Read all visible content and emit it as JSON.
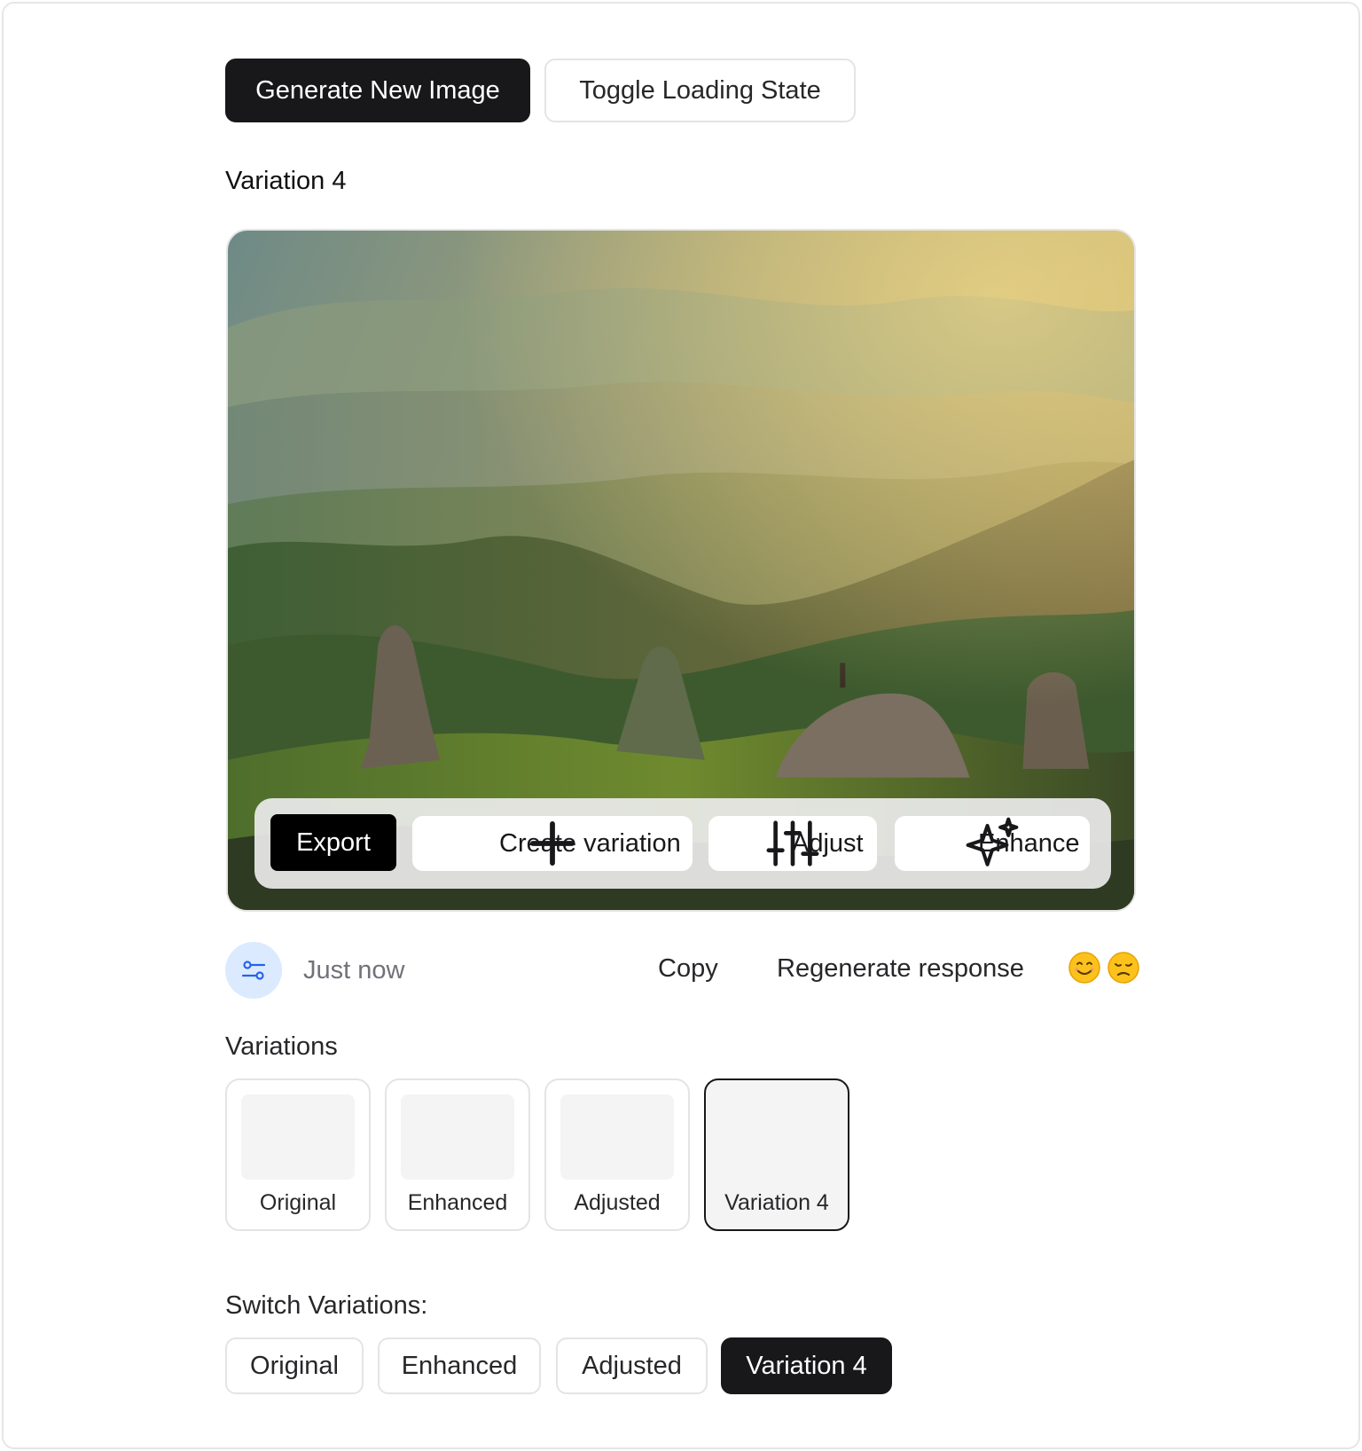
{
  "top_buttons": {
    "generate_label": "Generate New Image",
    "toggle_label": "Toggle Loading State"
  },
  "image": {
    "title": "Variation 4"
  },
  "toolbar": {
    "export_label": "Export",
    "create_label": "Create variation",
    "adjust_label": "Adjust",
    "enhance_label": "Enhance",
    "icons": [
      "plus-icon",
      "sliders-icon",
      "sparkle-icon"
    ]
  },
  "meta": {
    "avatar_icon": "settings-toggle-icon",
    "timestamp": "Just now",
    "copy_label": "Copy",
    "regenerate_label": "Regenerate response",
    "feedback_icons": [
      "smile-emoji",
      "pensive-emoji"
    ]
  },
  "variations": {
    "heading": "Variations",
    "items": [
      {
        "label": "Original",
        "selected": false
      },
      {
        "label": "Enhanced",
        "selected": false
      },
      {
        "label": "Adjusted",
        "selected": false
      },
      {
        "label": "Variation 4",
        "selected": true
      }
    ]
  },
  "switch": {
    "heading": "Switch Variations:",
    "options": [
      {
        "label": "Original",
        "selected": false
      },
      {
        "label": "Enhanced",
        "selected": false
      },
      {
        "label": "Adjusted",
        "selected": false
      },
      {
        "label": "Variation 4",
        "selected": true
      }
    ]
  },
  "colors": {
    "primary_dark": "#18181b",
    "avatar_bg": "#dbeafe",
    "avatar_icon": "#2563eb"
  }
}
